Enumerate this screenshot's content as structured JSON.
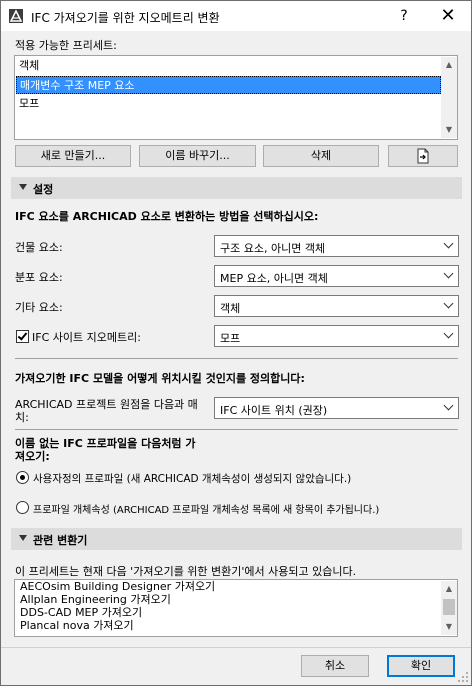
{
  "window": {
    "title": "IFC 가져오기를 위한 지오메트리 변환",
    "help_label": "?",
    "close_label": "✕"
  },
  "presets": {
    "label": "적용 가능한 프리세트:",
    "items": [
      "객체",
      "매개변수 구조 MEP 요소",
      "모프"
    ],
    "selected_index": 1,
    "buttons": {
      "new": "새로 만들기...",
      "rename": "이름 바꾸기...",
      "delete": "삭제"
    }
  },
  "settings": {
    "section_label": "설정",
    "heading": "IFC 요소를 ARCHICAD 요소로 변환하는 방법을 선택하십시오:",
    "rows": [
      {
        "label": "건물 요소:",
        "value": "구조 요소, 아니면 객체"
      },
      {
        "label": "분포 요소:",
        "value": "MEP 요소, 아니면 객체"
      },
      {
        "label": "기타 요소:",
        "value": "객체"
      }
    ],
    "site_geometry": {
      "label": "IFC 사이트 지오메트리:",
      "checked": true,
      "value": "모프"
    },
    "placement_heading": "가져오기한 IFC 모델을 어떻게 위치시킬 것인지를 정의합니다:",
    "origin_label_line1": "ARCHICAD 프로젝트 원점을 다음과 매",
    "origin_label_line2": "치:",
    "origin_value": "IFC 사이트 위치 (권장)",
    "profiles_heading_line1": "이름 없는 IFC 프로파일을 다음처럼 가",
    "profiles_heading_line2": "져오기:",
    "radio_custom": "사용자정의 프로파일 (새 ARCHICAD 개체속성이 생성되지 않았습니다.)",
    "radio_property": "프로파일 개체속성 (ARCHICAD 프로파일 개체속성 목록에 새 항목이 추가됩니다.)",
    "radio_selected": "custom"
  },
  "related": {
    "section_label": "관련 변환기",
    "description": "이 프리세트는 현재 다음 '가져오기를 위한 변환기'에서 사용되고 있습니다.",
    "items": [
      "AECOsim Building Designer 가져오기",
      "Allplan Engineering 가져오기",
      "DDS-CAD MEP 가져오기",
      "Plancal nova 가져오기"
    ]
  },
  "footer": {
    "cancel": "취소",
    "ok": "확인"
  }
}
